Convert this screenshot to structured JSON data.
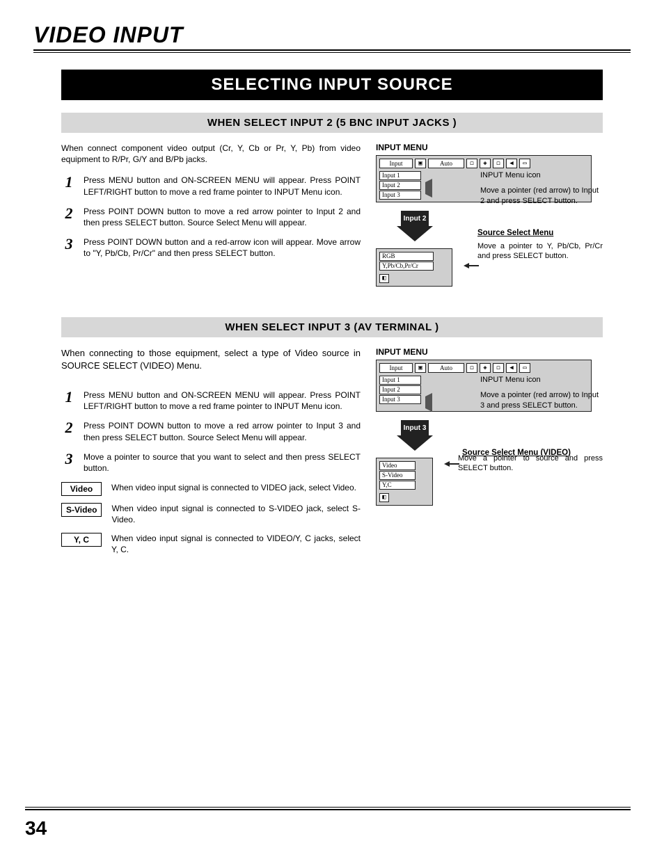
{
  "chapter": "VIDEO INPUT",
  "banner": "SELECTING INPUT SOURCE",
  "pageNumber": "34",
  "sectionA": {
    "heading": "WHEN SELECT INPUT 2 (5 BNC INPUT JACKS )",
    "intro": "When connect component video output (Cr, Y, Cb or Pr, Y, Pb) from video equipment to R/Pr, G/Y and B/Pb  jacks.",
    "steps": [
      "Press MENU button and ON-SCREEN MENU will appear.  Press POINT LEFT/RIGHT button to move a red frame pointer to INPUT Menu icon.",
      "Press POINT DOWN button to move a red arrow pointer to Input 2 and then press SELECT button.  Source Select Menu will appear.",
      "Press POINT DOWN button and a red-arrow icon will appear. Move arrow to \"Y, Pb/Cb, Pr/Cr\" and then press SELECT button."
    ],
    "figure": {
      "heading": "INPUT MENU",
      "topbar_label": "Input",
      "topbar_auto": "Auto",
      "inputs": [
        "Input 1",
        "Input 2",
        "Input 3"
      ],
      "annot_icon": "INPUT Menu icon",
      "annot_pointer": "Move a pointer (red arrow) to Input 2 and press SELECT button.",
      "arrow_label": "Input 2",
      "sub_heading": "Source Select Menu",
      "sources": [
        "RGB",
        "Y,Pb/Cb,Pr/Cr"
      ],
      "annot_source": "Move a pointer to Y, Pb/Cb, Pr/Cr and press SELECT button."
    }
  },
  "sectionB": {
    "heading": "WHEN SELECT INPUT 3 (AV TERMINAL )",
    "intro": "When connecting to those equipment, select a type of Video source in SOURCE SELECT (VIDEO) Menu.",
    "steps": [
      "Press MENU button and ON-SCREEN MENU will appear.  Press POINT LEFT/RIGHT button to move a red frame pointer to INPUT Menu icon.",
      "Press POINT DOWN button to move a red arrow pointer to Input 3 and then press SELECT button.  Source Select Menu will appear.",
      "Move a pointer to source that you want to select and then press SELECT button."
    ],
    "options": [
      {
        "label": "Video",
        "desc": "When video input signal is connected to VIDEO jack, select Video."
      },
      {
        "label": "S-Video",
        "desc": "When video input signal is connected to S-VIDEO jack, select S-Video."
      },
      {
        "label": "Y, C",
        "desc": "When video input signal is connected to VIDEO/Y, C jacks, select Y, C."
      }
    ],
    "figure": {
      "heading": "INPUT MENU",
      "topbar_label": "Input",
      "topbar_auto": "Auto",
      "inputs": [
        "Input 1",
        "Input 2",
        "Input 3"
      ],
      "annot_icon": "INPUT Menu icon",
      "annot_pointer": "Move a pointer (red arrow) to Input 3 and press SELECT button.",
      "arrow_label": "Input 3",
      "sub_heading": "Source Select Menu (VIDEO)",
      "sources": [
        "Video",
        "S-Video",
        "Y,C"
      ],
      "annot_source": "Move a pointer to source and press SELECT button."
    }
  }
}
